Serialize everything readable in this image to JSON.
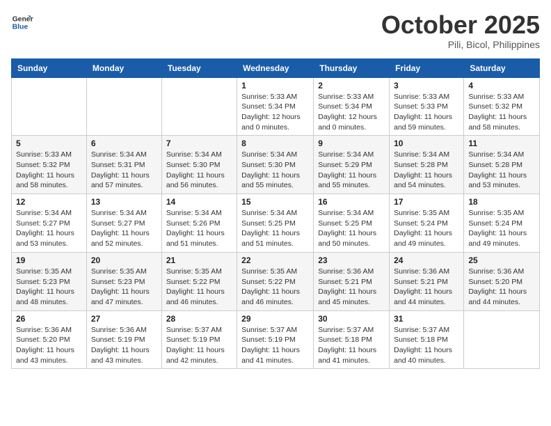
{
  "header": {
    "logo_line1": "General",
    "logo_line2": "Blue",
    "month": "October 2025",
    "location": "Pili, Bicol, Philippines"
  },
  "weekdays": [
    "Sunday",
    "Monday",
    "Tuesday",
    "Wednesday",
    "Thursday",
    "Friday",
    "Saturday"
  ],
  "weeks": [
    [
      {
        "day": "",
        "sunrise": "",
        "sunset": "",
        "daylight": ""
      },
      {
        "day": "",
        "sunrise": "",
        "sunset": "",
        "daylight": ""
      },
      {
        "day": "",
        "sunrise": "",
        "sunset": "",
        "daylight": ""
      },
      {
        "day": "1",
        "sunrise": "Sunrise: 5:33 AM",
        "sunset": "Sunset: 5:34 PM",
        "daylight": "Daylight: 12 hours and 0 minutes."
      },
      {
        "day": "2",
        "sunrise": "Sunrise: 5:33 AM",
        "sunset": "Sunset: 5:34 PM",
        "daylight": "Daylight: 12 hours and 0 minutes."
      },
      {
        "day": "3",
        "sunrise": "Sunrise: 5:33 AM",
        "sunset": "Sunset: 5:33 PM",
        "daylight": "Daylight: 11 hours and 59 minutes."
      },
      {
        "day": "4",
        "sunrise": "Sunrise: 5:33 AM",
        "sunset": "Sunset: 5:32 PM",
        "daylight": "Daylight: 11 hours and 58 minutes."
      }
    ],
    [
      {
        "day": "5",
        "sunrise": "Sunrise: 5:33 AM",
        "sunset": "Sunset: 5:32 PM",
        "daylight": "Daylight: 11 hours and 58 minutes."
      },
      {
        "day": "6",
        "sunrise": "Sunrise: 5:34 AM",
        "sunset": "Sunset: 5:31 PM",
        "daylight": "Daylight: 11 hours and 57 minutes."
      },
      {
        "day": "7",
        "sunrise": "Sunrise: 5:34 AM",
        "sunset": "Sunset: 5:30 PM",
        "daylight": "Daylight: 11 hours and 56 minutes."
      },
      {
        "day": "8",
        "sunrise": "Sunrise: 5:34 AM",
        "sunset": "Sunset: 5:30 PM",
        "daylight": "Daylight: 11 hours and 55 minutes."
      },
      {
        "day": "9",
        "sunrise": "Sunrise: 5:34 AM",
        "sunset": "Sunset: 5:29 PM",
        "daylight": "Daylight: 11 hours and 55 minutes."
      },
      {
        "day": "10",
        "sunrise": "Sunrise: 5:34 AM",
        "sunset": "Sunset: 5:28 PM",
        "daylight": "Daylight: 11 hours and 54 minutes."
      },
      {
        "day": "11",
        "sunrise": "Sunrise: 5:34 AM",
        "sunset": "Sunset: 5:28 PM",
        "daylight": "Daylight: 11 hours and 53 minutes."
      }
    ],
    [
      {
        "day": "12",
        "sunrise": "Sunrise: 5:34 AM",
        "sunset": "Sunset: 5:27 PM",
        "daylight": "Daylight: 11 hours and 53 minutes."
      },
      {
        "day": "13",
        "sunrise": "Sunrise: 5:34 AM",
        "sunset": "Sunset: 5:27 PM",
        "daylight": "Daylight: 11 hours and 52 minutes."
      },
      {
        "day": "14",
        "sunrise": "Sunrise: 5:34 AM",
        "sunset": "Sunset: 5:26 PM",
        "daylight": "Daylight: 11 hours and 51 minutes."
      },
      {
        "day": "15",
        "sunrise": "Sunrise: 5:34 AM",
        "sunset": "Sunset: 5:25 PM",
        "daylight": "Daylight: 11 hours and 51 minutes."
      },
      {
        "day": "16",
        "sunrise": "Sunrise: 5:34 AM",
        "sunset": "Sunset: 5:25 PM",
        "daylight": "Daylight: 11 hours and 50 minutes."
      },
      {
        "day": "17",
        "sunrise": "Sunrise: 5:35 AM",
        "sunset": "Sunset: 5:24 PM",
        "daylight": "Daylight: 11 hours and 49 minutes."
      },
      {
        "day": "18",
        "sunrise": "Sunrise: 5:35 AM",
        "sunset": "Sunset: 5:24 PM",
        "daylight": "Daylight: 11 hours and 49 minutes."
      }
    ],
    [
      {
        "day": "19",
        "sunrise": "Sunrise: 5:35 AM",
        "sunset": "Sunset: 5:23 PM",
        "daylight": "Daylight: 11 hours and 48 minutes."
      },
      {
        "day": "20",
        "sunrise": "Sunrise: 5:35 AM",
        "sunset": "Sunset: 5:23 PM",
        "daylight": "Daylight: 11 hours and 47 minutes."
      },
      {
        "day": "21",
        "sunrise": "Sunrise: 5:35 AM",
        "sunset": "Sunset: 5:22 PM",
        "daylight": "Daylight: 11 hours and 46 minutes."
      },
      {
        "day": "22",
        "sunrise": "Sunrise: 5:35 AM",
        "sunset": "Sunset: 5:22 PM",
        "daylight": "Daylight: 11 hours and 46 minutes."
      },
      {
        "day": "23",
        "sunrise": "Sunrise: 5:36 AM",
        "sunset": "Sunset: 5:21 PM",
        "daylight": "Daylight: 11 hours and 45 minutes."
      },
      {
        "day": "24",
        "sunrise": "Sunrise: 5:36 AM",
        "sunset": "Sunset: 5:21 PM",
        "daylight": "Daylight: 11 hours and 44 minutes."
      },
      {
        "day": "25",
        "sunrise": "Sunrise: 5:36 AM",
        "sunset": "Sunset: 5:20 PM",
        "daylight": "Daylight: 11 hours and 44 minutes."
      }
    ],
    [
      {
        "day": "26",
        "sunrise": "Sunrise: 5:36 AM",
        "sunset": "Sunset: 5:20 PM",
        "daylight": "Daylight: 11 hours and 43 minutes."
      },
      {
        "day": "27",
        "sunrise": "Sunrise: 5:36 AM",
        "sunset": "Sunset: 5:19 PM",
        "daylight": "Daylight: 11 hours and 43 minutes."
      },
      {
        "day": "28",
        "sunrise": "Sunrise: 5:37 AM",
        "sunset": "Sunset: 5:19 PM",
        "daylight": "Daylight: 11 hours and 42 minutes."
      },
      {
        "day": "29",
        "sunrise": "Sunrise: 5:37 AM",
        "sunset": "Sunset: 5:19 PM",
        "daylight": "Daylight: 11 hours and 41 minutes."
      },
      {
        "day": "30",
        "sunrise": "Sunrise: 5:37 AM",
        "sunset": "Sunset: 5:18 PM",
        "daylight": "Daylight: 11 hours and 41 minutes."
      },
      {
        "day": "31",
        "sunrise": "Sunrise: 5:37 AM",
        "sunset": "Sunset: 5:18 PM",
        "daylight": "Daylight: 11 hours and 40 minutes."
      },
      {
        "day": "",
        "sunrise": "",
        "sunset": "",
        "daylight": ""
      }
    ]
  ]
}
